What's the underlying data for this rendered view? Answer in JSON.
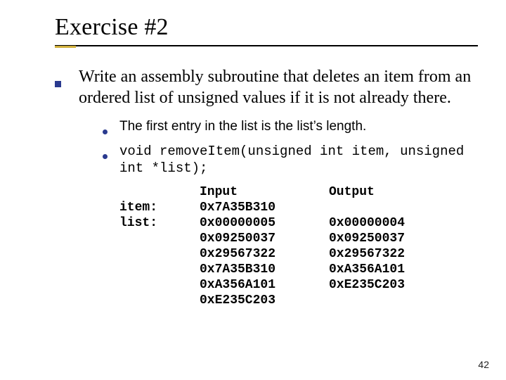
{
  "title": "Exercise #2",
  "main_text": "Write an assembly subroutine that deletes an item from an ordered list of unsigned values if it is not already there.",
  "sub": {
    "first": "The first entry in the list is the list’s length.",
    "proto": "void removeItem(unsigned int item, unsigned int *list);"
  },
  "labels": {
    "item": "item:",
    "list": "list:"
  },
  "headers": {
    "input": "Input",
    "output": "Output"
  },
  "input": [
    "0x7A35B310",
    "0x00000005",
    "0x09250037",
    "0x29567322",
    "0x7A35B310",
    "0xA356A101",
    "0xE235C203"
  ],
  "output": [
    "0x00000004",
    "0x09250037",
    "0x29567322",
    "0xA356A101",
    "0xE235C203"
  ],
  "page": "42"
}
